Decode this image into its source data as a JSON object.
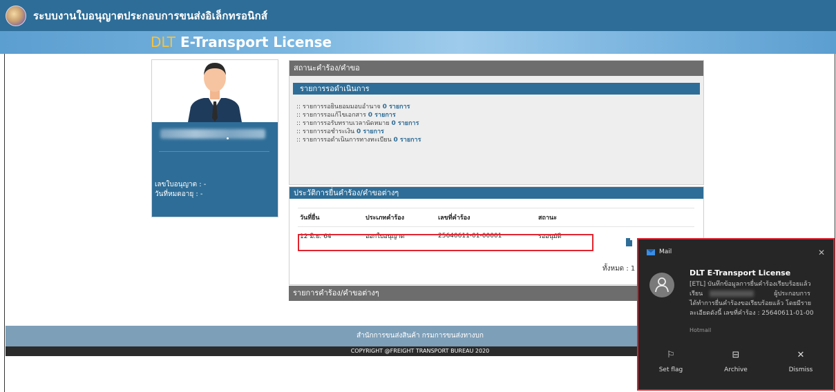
{
  "topbar": {
    "title": "ระบบงานใบอนุญาตประกอบการขนส่งอิเล็กทรอนิกส์",
    "logo_icon": "agency-seal-icon"
  },
  "banner": {
    "brand_prefix": "DLT",
    "brand_rest": " E-Transport License"
  },
  "profile": {
    "license_label": "เลขใบอนุญาต : -",
    "expiry_label": "วันที่หมดอายุ : -"
  },
  "status_panel": {
    "title": "สถานะคำร้อง/คำขอ",
    "pending_title": "รายการรอดำเนินการ",
    "items": [
      {
        "label": ":: รายการรอยินยอมมอบอำนาจ",
        "count": "0 รายการ"
      },
      {
        "label": ":: รายการรอแก้ไขเอกสาร",
        "count": "0 รายการ"
      },
      {
        "label": ":: รายการรอรับทราบเวลานัดหมาย",
        "count": "0 รายการ"
      },
      {
        "label": ":: รายการรอชำระเงิน",
        "count": "0 รายการ"
      },
      {
        "label": ":: รายการรอดำเนินการทางทะเบียน",
        "count": "0 รายการ"
      }
    ]
  },
  "history": {
    "title": "ประวัติการยื่นคำร้อง/คำขอต่างๆ",
    "columns": [
      "วันที่ยื่น",
      "ประเภทคำร้อง",
      "เลขที่คำร้อง",
      "สถานะ"
    ],
    "rows": [
      {
        "date": "12 มิ.ย. 64",
        "type": "ออกใบอนุญาต",
        "number": "25640611-01-00001",
        "status": "รออนุมัติ"
      }
    ],
    "total": "ทั้งหมด : 1"
  },
  "requests_panel": {
    "title": "รายการคำร้อง/คำขอต่างๆ"
  },
  "footer": {
    "org": "สำนักการขนส่งสินค้า กรมการขนส่งทางบก",
    "copyright": "COPYRIGHT @FREIGHT TRANSPORT BUREAU 2020"
  },
  "toast": {
    "app": "Mail",
    "title": "DLT E-Transport License",
    "body_line1": "[ETL] บันทึกข้อมูลการยื่นคำร้องเรียบร้อยแล้ว",
    "body_line2a": "เรียน",
    "body_line2b": "ผู้ประกอบการ",
    "body_line3": "ได้ทำการยื่นคำร้องขอเรียบร้อยแล้ว โดยมีราย",
    "body_line4": "ละเอียดดังนี้ เลขที่คำร้อง : 25640611-01-00",
    "source": "Hotmail",
    "actions": [
      {
        "label": "Set flag",
        "icon": "flag-icon"
      },
      {
        "label": "Archive",
        "icon": "archive-icon"
      },
      {
        "label": "Dismiss",
        "icon": "close-icon"
      }
    ]
  },
  "colors": {
    "primary": "#2e6d97",
    "panel_head": "#6d6d6d",
    "highlight": "#e0242f",
    "brand_yellow": "#f6c23e"
  }
}
